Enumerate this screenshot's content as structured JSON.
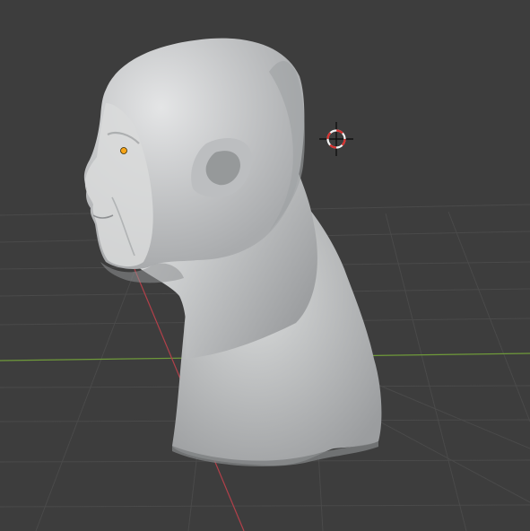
{
  "app": "3D Viewport",
  "scene": {
    "object": "head-bust-sculpt",
    "view": "side-perspective",
    "shading": "solid"
  },
  "colors": {
    "background": "#3d3d3d",
    "grid_line": "#4a4a4a",
    "x_axis": "#b2404a",
    "y_axis": "#6f9a3a",
    "mesh_base": "#c4c6c7",
    "origin_dot": "#f6a417",
    "cursor_red": "#d8302e",
    "cursor_white": "#f2f2f2",
    "cursor_black": "#111111"
  },
  "icons": {
    "cursor": "3d-cursor-icon",
    "origin": "object-origin-dot-icon"
  }
}
